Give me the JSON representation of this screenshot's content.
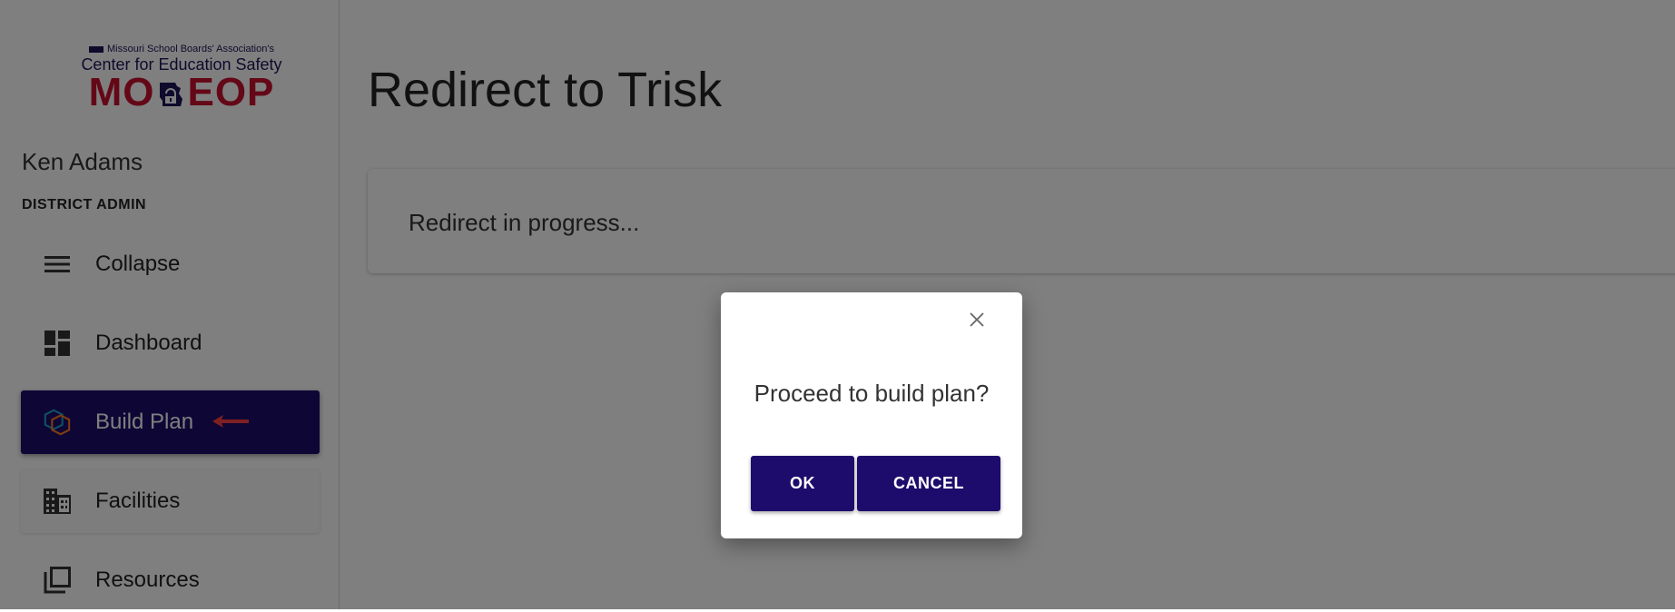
{
  "logo": {
    "top_line": "Missouri School Boards' Association's",
    "mid_line": "Center for Education Safety",
    "big_left": "MO",
    "big_right": "EOP"
  },
  "user": {
    "name": "Ken Adams",
    "role": "DISTRICT ADMIN"
  },
  "sidebar": {
    "items": [
      {
        "label": "Collapse",
        "icon": "menu-icon"
      },
      {
        "label": "Dashboard",
        "icon": "dashboard-icon"
      },
      {
        "label": "Build Plan",
        "icon": "build-plan-hexagon-icon",
        "active": true
      },
      {
        "label": "Facilities",
        "icon": "building-icon"
      },
      {
        "label": "Resources",
        "icon": "library-icon"
      }
    ]
  },
  "main": {
    "title": "Redirect to Trisk",
    "card_text": "Redirect in progress..."
  },
  "dialog": {
    "question": "Proceed to build plan?",
    "ok_label": "OK",
    "cancel_label": "CANCEL"
  },
  "colors": {
    "primary": "#1d0c6b",
    "logo_red": "#c8102e",
    "arrow_red": "#ff4040"
  }
}
